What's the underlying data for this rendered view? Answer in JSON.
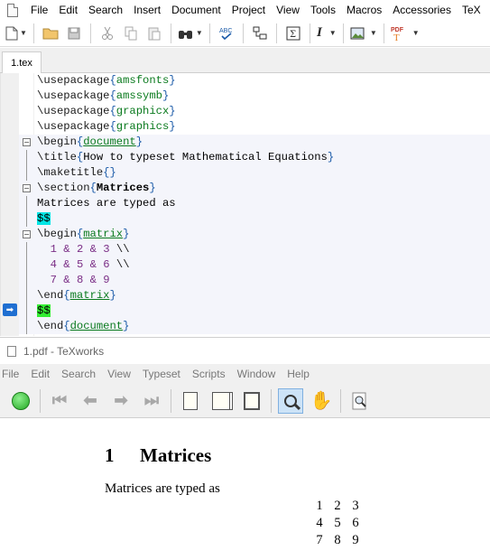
{
  "editor": {
    "menu": [
      "File",
      "Edit",
      "Search",
      "Insert",
      "Document",
      "Project",
      "View",
      "Tools",
      "Macros",
      "Accessories",
      "TeX"
    ],
    "tab_label": "1.tex",
    "lines": [
      {
        "cmd": "\\usepackage",
        "arg": "amsfonts"
      },
      {
        "cmd": "\\usepackage",
        "arg": "amssymb"
      },
      {
        "cmd": "\\usepackage",
        "arg": "graphicx"
      },
      {
        "cmd": "\\usepackage",
        "arg": "graphics"
      },
      {
        "cmd": "\\begin",
        "arg": "document"
      },
      {
        "cmd": "\\title",
        "arg": "How to typeset Mathematical Equations"
      },
      {
        "cmd": "\\maketitle",
        "arg": ""
      },
      {
        "cmd": "\\section",
        "arg": "Matrices"
      },
      {
        "text": "Matrices are typed as"
      },
      {
        "math": "$$"
      },
      {
        "cmd": "\\begin",
        "arg": "matrix"
      },
      {
        "row": [
          "1",
          "2",
          "3"
        ],
        "end": "\\\\"
      },
      {
        "row": [
          "4",
          "5",
          "6"
        ],
        "end": "\\\\"
      },
      {
        "row": [
          "7",
          "8",
          "9"
        ],
        "end": ""
      },
      {
        "cmd": "\\end",
        "arg": "matrix"
      },
      {
        "math": "$$"
      },
      {
        "cmd": "\\end",
        "arg": "document"
      }
    ],
    "amp": "&"
  },
  "pdf": {
    "window_title": "1.pdf - TeXworks",
    "menu": [
      "File",
      "Edit",
      "Search",
      "View",
      "Typeset",
      "Scripts",
      "Window",
      "Help"
    ],
    "section_number": "1",
    "section_title": "Matrices",
    "paragraph": "Matrices are typed as",
    "matrix": [
      [
        "1",
        "2",
        "3"
      ],
      [
        "4",
        "5",
        "6"
      ],
      [
        "7",
        "8",
        "9"
      ]
    ]
  },
  "icons": [
    "new-file-icon",
    "open-folder-icon",
    "save-icon",
    "cut-icon",
    "copy-icon",
    "paste-icon",
    "find-icon",
    "spellcheck-icon",
    "structure-icon",
    "math-icon",
    "italic-icon",
    "image-icon",
    "pdf-icon",
    "typeset-go-icon",
    "first-page-icon",
    "previous-page-icon",
    "next-page-icon",
    "last-page-icon",
    "actual-size-icon",
    "fit-width-icon",
    "fit-page-icon",
    "magnify-icon",
    "hand-icon",
    "zoom-icon"
  ]
}
